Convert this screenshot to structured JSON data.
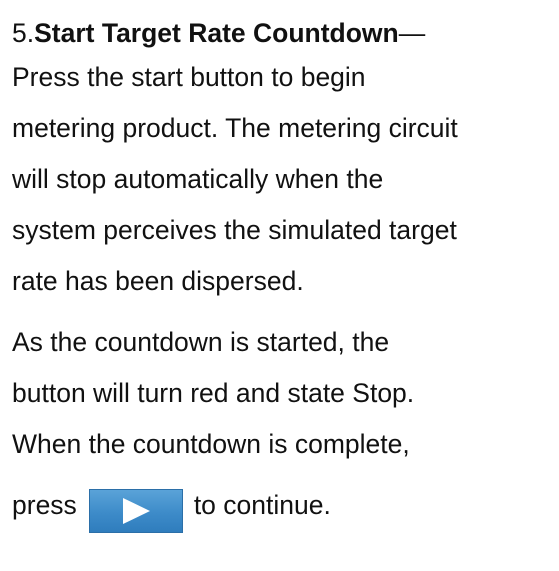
{
  "step": {
    "number": "5.",
    "title": "Start Target Rate Countdown",
    "dash": "—"
  },
  "paragraph1": [
    "Press the start button to begin",
    "metering product. The metering circuit",
    "will stop automatically when the",
    "system perceives the simulated target",
    "rate has been dispersed."
  ],
  "paragraph2": [
    "As the countdown is started, the",
    "button will turn red and state Stop.",
    "When the countdown is complete,"
  ],
  "final": {
    "before": "press",
    "after": "to continue.",
    "button_icon": "play-icon",
    "button_color": "#3d8bc9"
  }
}
